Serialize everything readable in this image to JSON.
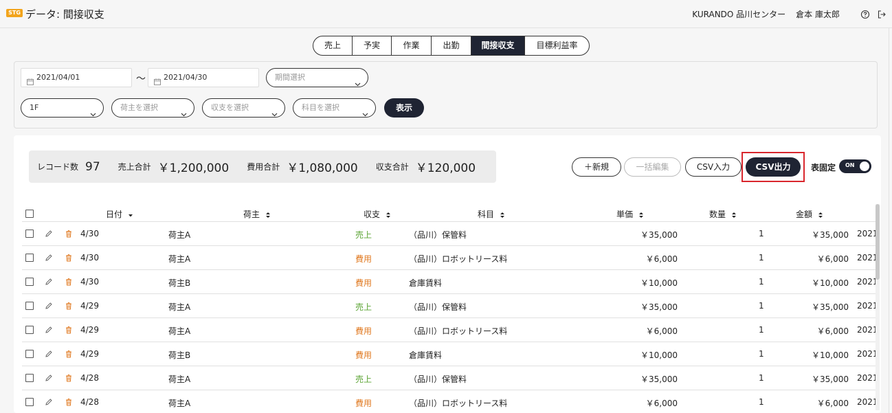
{
  "header": {
    "badge": "STG",
    "title": "データ: 間接収支",
    "company": "KURANDO 品川センター",
    "user": "倉本 庫太郎",
    "help_icon": "question-circle-icon",
    "logout_icon": "logout-icon"
  },
  "tabs": [
    {
      "label": "売上",
      "active": false
    },
    {
      "label": "予実",
      "active": false
    },
    {
      "label": "作業",
      "active": false
    },
    {
      "label": "出勤",
      "active": false
    },
    {
      "label": "間接収支",
      "active": true
    },
    {
      "label": "目標利益率",
      "active": false
    }
  ],
  "filters": {
    "date_from": "2021/04/01",
    "date_to": "2021/04/30",
    "separator": "〜",
    "period_placeholder": "期間選択",
    "floor_value": "1F",
    "shipper_placeholder": "荷主を選択",
    "kind_placeholder": "収支を選択",
    "account_placeholder": "科目を選択",
    "show_button": "表示"
  },
  "summary": {
    "record_label": "レコード数",
    "record_value": "97",
    "sales_label": "売上合計",
    "sales_value": "￥1,200,000",
    "cost_label": "費用合計",
    "cost_value": "￥1,080,000",
    "balance_label": "収支合計",
    "balance_value": "￥120,000"
  },
  "actions": {
    "new": "＋新規",
    "bulk_edit": "一括編集",
    "csv_in": "CSV入力",
    "csv_out": "CSV出力",
    "fix_label": "表固定",
    "toggle_text": "ON"
  },
  "columns": {
    "date": "日付",
    "shipper": "荷主",
    "kind": "収支",
    "account": "科目",
    "unit_price": "単価",
    "quantity": "数量",
    "amount": "金額"
  },
  "rows": [
    {
      "date": "4/30",
      "shipper": "荷主A",
      "kind": "売上",
      "kind_type": "sale",
      "account": "（品川）保管料",
      "unit_price": "￥35,000",
      "quantity": "1",
      "amount": "￥35,000",
      "extra": "2021"
    },
    {
      "date": "4/30",
      "shipper": "荷主A",
      "kind": "費用",
      "kind_type": "cost",
      "account": "（品川）ロボットリース料",
      "unit_price": "￥6,000",
      "quantity": "1",
      "amount": "￥6,000",
      "extra": "2021"
    },
    {
      "date": "4/30",
      "shipper": "荷主B",
      "kind": "費用",
      "kind_type": "cost",
      "account": "倉庫賃料",
      "unit_price": "￥10,000",
      "quantity": "1",
      "amount": "￥10,000",
      "extra": "2021"
    },
    {
      "date": "4/29",
      "shipper": "荷主A",
      "kind": "売上",
      "kind_type": "sale",
      "account": "（品川）保管料",
      "unit_price": "￥35,000",
      "quantity": "1",
      "amount": "￥35,000",
      "extra": "2021"
    },
    {
      "date": "4/29",
      "shipper": "荷主A",
      "kind": "費用",
      "kind_type": "cost",
      "account": "（品川）ロボットリース料",
      "unit_price": "￥6,000",
      "quantity": "1",
      "amount": "￥6,000",
      "extra": "2021"
    },
    {
      "date": "4/29",
      "shipper": "荷主B",
      "kind": "費用",
      "kind_type": "cost",
      "account": "倉庫賃料",
      "unit_price": "￥10,000",
      "quantity": "1",
      "amount": "￥10,000",
      "extra": "2021"
    },
    {
      "date": "4/28",
      "shipper": "荷主A",
      "kind": "売上",
      "kind_type": "sale",
      "account": "（品川）保管料",
      "unit_price": "￥35,000",
      "quantity": "1",
      "amount": "￥35,000",
      "extra": "2021"
    },
    {
      "date": "4/28",
      "shipper": "荷主A",
      "kind": "費用",
      "kind_type": "cost",
      "account": "（品川）ロボットリース料",
      "unit_price": "￥6,000",
      "quantity": "1",
      "amount": "￥6,000",
      "extra": "2021"
    }
  ],
  "colors": {
    "accent_dark": "#1f2433",
    "sale": "#5aa332",
    "cost": "#e07a22",
    "badge": "#f2a41c",
    "highlight": "#d9262c"
  }
}
